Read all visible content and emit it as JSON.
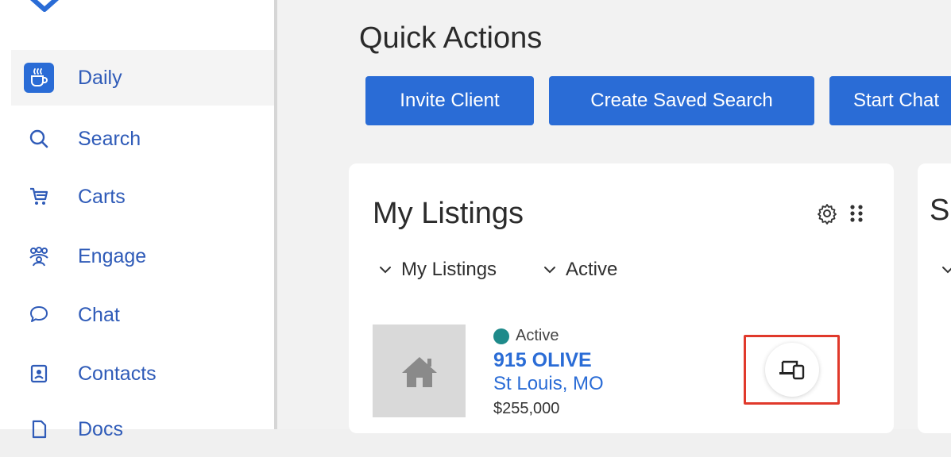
{
  "sidebar": {
    "items": [
      {
        "label": "Daily",
        "icon": "coffee-cup-icon",
        "active": true
      },
      {
        "label": "Search",
        "icon": "search-icon"
      },
      {
        "label": "Carts",
        "icon": "cart-icon"
      },
      {
        "label": "Engage",
        "icon": "people-icon"
      },
      {
        "label": "Chat",
        "icon": "chat-bubble-icon"
      },
      {
        "label": "Contacts",
        "icon": "contact-card-icon"
      },
      {
        "label": "Docs",
        "icon": "document-icon"
      }
    ]
  },
  "quick_actions": {
    "title": "Quick Actions",
    "buttons": [
      "Invite Client",
      "Create Saved Search",
      "Start Chat"
    ]
  },
  "my_listings": {
    "title": "My Listings",
    "filters": [
      "My Listings",
      "Active"
    ],
    "listing": {
      "status": "Active",
      "address": "915 OLIVE",
      "city": "St Louis, MO",
      "price": "$255,000"
    }
  },
  "next_card": {
    "title_partial": "S"
  },
  "colors": {
    "accent": "#2a6cd6",
    "status_active": "#1e8a8a",
    "highlight": "#e0392b"
  }
}
